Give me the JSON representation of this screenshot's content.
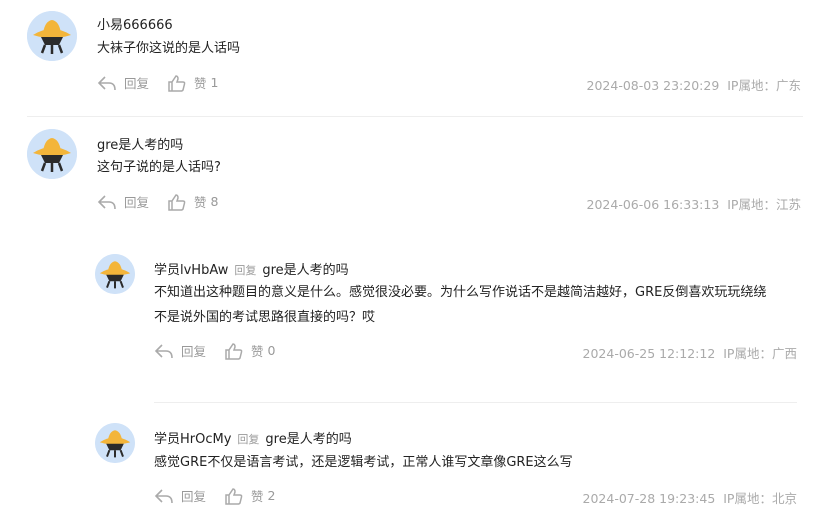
{
  "colors": {
    "avatar_bg": "#cfe2f8",
    "hat": "#f3b53a",
    "muted": "#999999",
    "divider": "#eeeeee"
  },
  "labels": {
    "reply": "回复",
    "like": "赞",
    "ip_prefix": "IP属地："
  },
  "comments": [
    {
      "user": "小易666666",
      "text": "大袜子你这说的是人话吗",
      "likes": "1",
      "time": "2024-08-03 23:20:29",
      "ip": "广东"
    },
    {
      "user": "gre是人考的吗",
      "text": "这句子说的是人话吗?",
      "likes": "8",
      "time": "2024-06-06 16:33:13",
      "ip": "江苏"
    }
  ],
  "replies": [
    {
      "user": "学员lvHbAw",
      "reply_word": "回复",
      "target": "gre是人考的吗",
      "text_lines": [
        "不知道出这种题目的意义是什么。感觉很没必要。为什么写作说话不是越简洁越好，GRE反倒喜欢玩玩绕绕",
        "不是说外国的考试思路很直接的吗？哎"
      ],
      "likes": "0",
      "time": "2024-06-25 12:12:12",
      "ip": "广西"
    },
    {
      "user": "学员HrOcMy",
      "reply_word": "回复",
      "target": "gre是人考的吗",
      "text_lines": [
        "感觉GRE不仅是语言考试，还是逻辑考试，正常人谁写文章像GRE这么写"
      ],
      "likes": "2",
      "time": "2024-07-28 19:23:45",
      "ip": "北京"
    }
  ]
}
